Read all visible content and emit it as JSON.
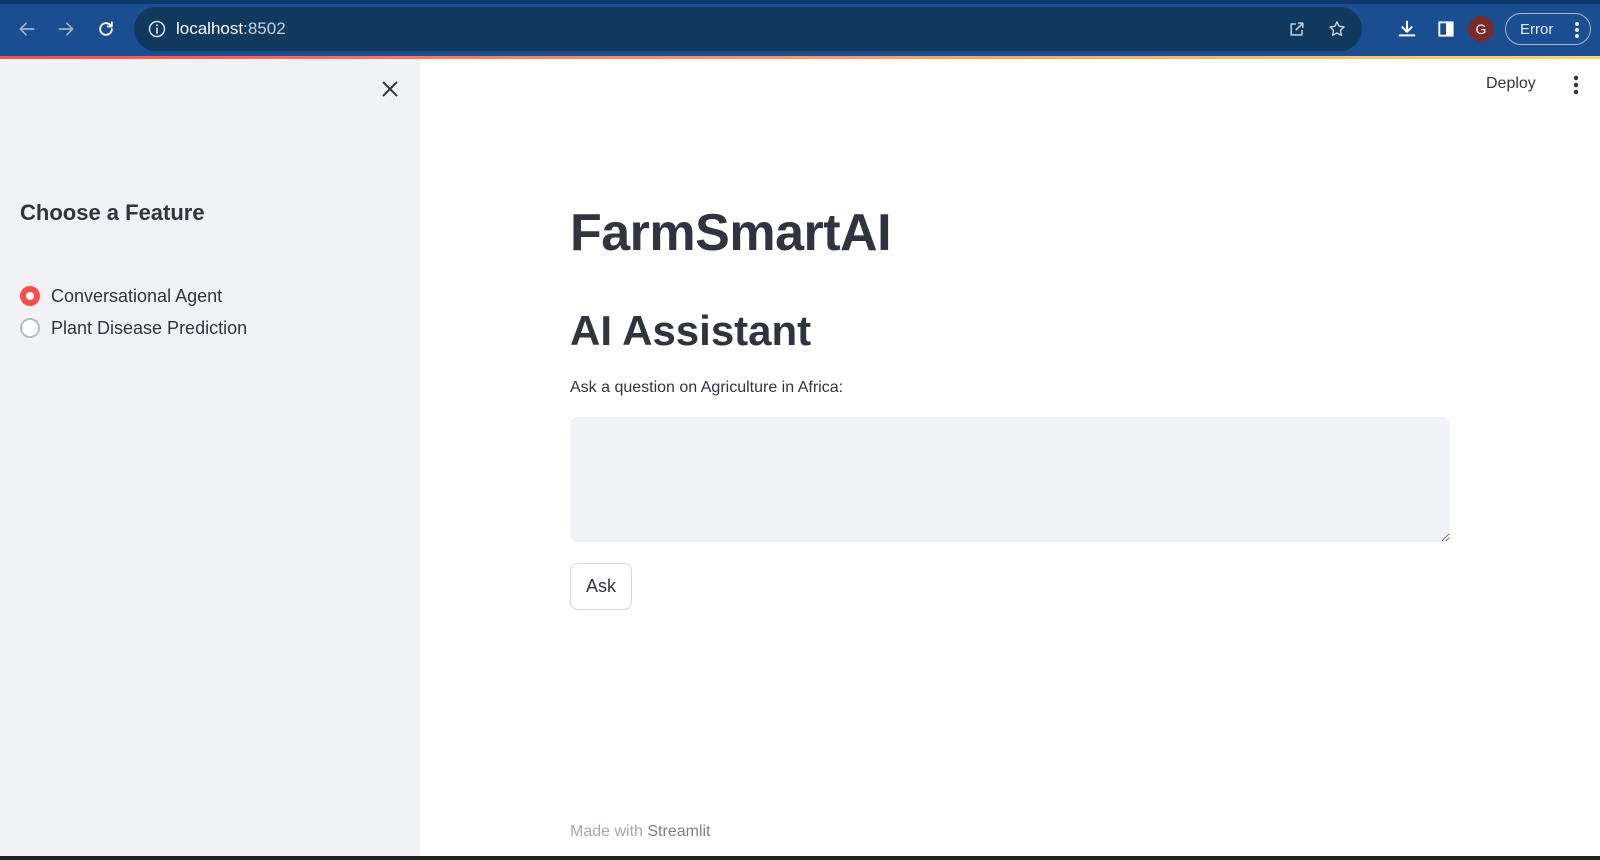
{
  "browser": {
    "url_host": "localhost",
    "url_port": ":8502",
    "profile_initial": "G",
    "error_label": "Error",
    "icons": [
      "back-icon",
      "forward-icon",
      "reload-icon",
      "info-icon",
      "share-icon",
      "star-icon",
      "download-icon",
      "sidebar-icon",
      "more-vert-icon"
    ]
  },
  "sidebar": {
    "title": "Choose a Feature",
    "options": [
      {
        "label": "Conversational Agent",
        "selected": true
      },
      {
        "label": "Plant Disease Prediction",
        "selected": false
      }
    ]
  },
  "header": {
    "deploy_label": "Deploy"
  },
  "main": {
    "title": "FarmSmartAI",
    "subtitle": "AI Assistant",
    "input_label": "Ask a question on Agriculture in Africa:",
    "input_value": "",
    "ask_button": "Ask"
  },
  "footer": {
    "prefix": "Made with",
    "brand": "Streamlit"
  },
  "colors": {
    "chrome": "#1a4e91",
    "accent": "#ff4b4b",
    "sidebar_bg": "#f0f2f6",
    "text": "#31333f"
  }
}
